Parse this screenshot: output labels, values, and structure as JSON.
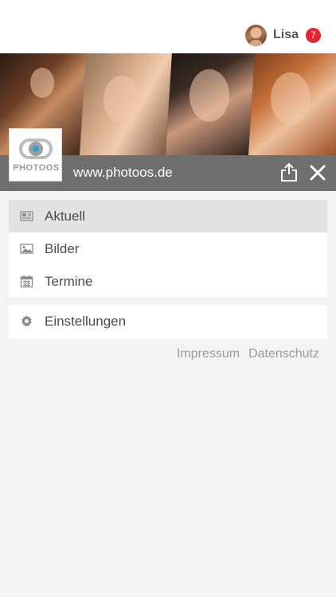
{
  "user": {
    "name": "Lisa",
    "badge_count": "7",
    "avatar_icon": "user-avatar"
  },
  "site": {
    "url": "www.photoos.de",
    "logo_text": "PHOTOOS"
  },
  "menu_main": [
    {
      "label": "Aktuell",
      "icon": "newspaper-icon",
      "active": true
    },
    {
      "label": "Bilder",
      "icon": "image-icon",
      "active": false
    },
    {
      "label": "Termine",
      "icon": "calendar-icon",
      "active": false
    }
  ],
  "menu_settings": {
    "label": "Einstellungen",
    "icon": "gear-icon"
  },
  "footer_links": {
    "impressum": "Impressum",
    "datenschutz": "Datenschutz"
  },
  "colors": {
    "badge": "#e8262f",
    "urlbar": "#6f6f6f",
    "active_item": "#e2e2e2",
    "logo_accent": "#2fa3d6"
  }
}
